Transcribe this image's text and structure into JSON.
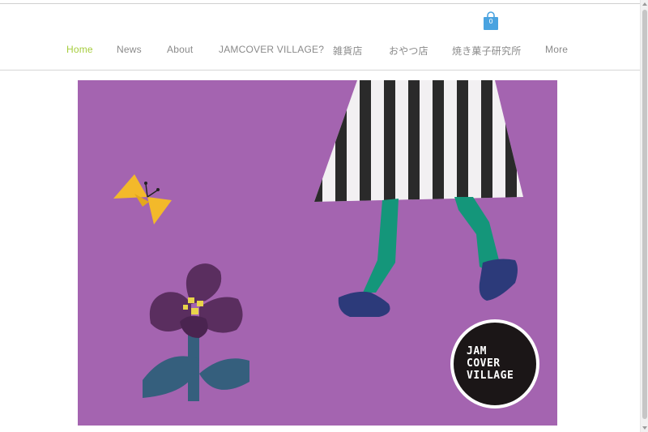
{
  "cart": {
    "count": "0",
    "icon": "shopping-bag-icon",
    "color": "#4aa3e0"
  },
  "nav": {
    "items": [
      {
        "label": "Home",
        "active": true
      },
      {
        "label": "News"
      },
      {
        "label": "About"
      },
      {
        "label": "JAMCOVER VILLAGE?"
      },
      {
        "label": "雑貨店"
      },
      {
        "label": "おやつ店"
      },
      {
        "label": "焼き菓子研究所"
      },
      {
        "label": "More"
      }
    ],
    "active_color": "#a6cd3d",
    "text_color": "#8a8a8a"
  },
  "hero": {
    "background": "#a464b0",
    "logo_lines": [
      "JAM",
      "COVER",
      "VILLAGE"
    ]
  }
}
